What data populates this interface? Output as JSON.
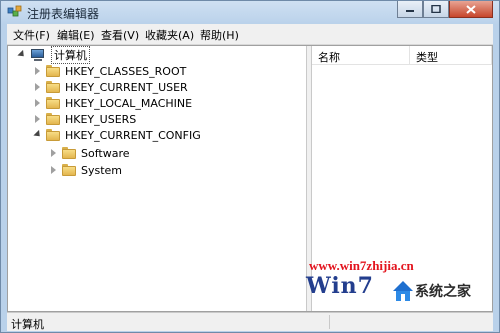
{
  "window": {
    "title": "注册表编辑器"
  },
  "menu": [
    {
      "label": "文件(F)"
    },
    {
      "label": "编辑(E)"
    },
    {
      "label": "查看(V)"
    },
    {
      "label": "收藏夹(A)"
    },
    {
      "label": "帮助(H)"
    }
  ],
  "tree": {
    "root": "计算机",
    "children": [
      {
        "label": "HKEY_CLASSES_ROOT"
      },
      {
        "label": "HKEY_CURRENT_USER"
      },
      {
        "label": "HKEY_LOCAL_MACHINE"
      },
      {
        "label": "HKEY_USERS"
      },
      {
        "label": "HKEY_CURRENT_CONFIG"
      }
    ],
    "config_children": [
      {
        "label": "Software"
      },
      {
        "label": "System"
      }
    ]
  },
  "list": {
    "columns": [
      "名称",
      "类型"
    ]
  },
  "status": {
    "path": "计算机"
  },
  "watermark": {
    "url": "www.win7zhijia.cn",
    "logo_text": "系统之家",
    "win_word": "Win7"
  },
  "colors": {
    "accent_red": "#e3141e",
    "folder": "#e3b64e",
    "close_button": "#c7452b"
  }
}
